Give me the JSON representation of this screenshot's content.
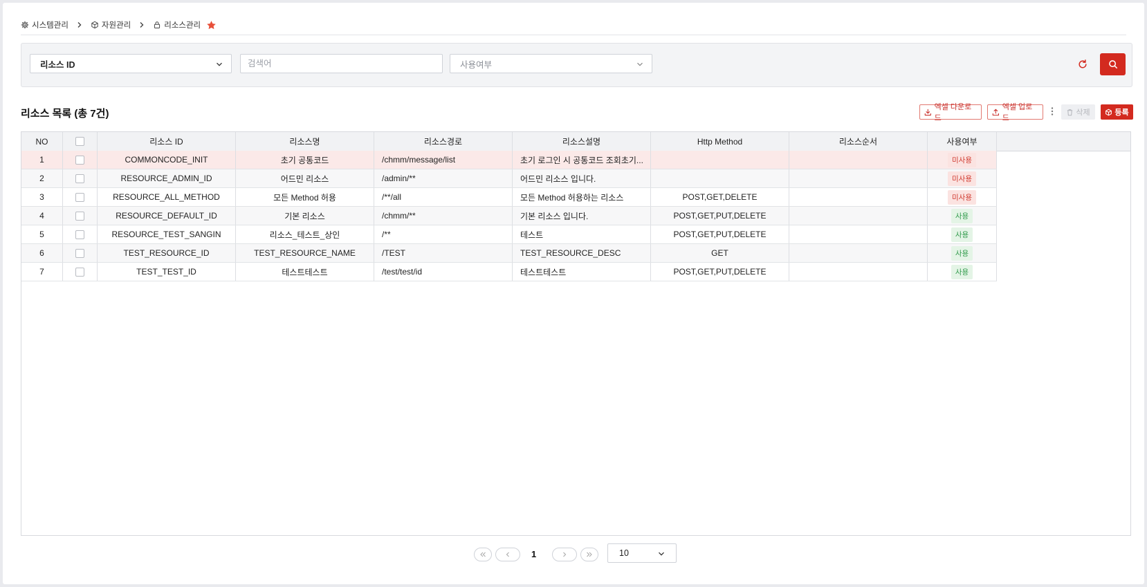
{
  "breadcrumb": {
    "items": [
      {
        "label": "시스템관리",
        "icon": "gear-icon"
      },
      {
        "label": "자원관리",
        "icon": "cube-icon"
      },
      {
        "label": "리소스관리",
        "icon": "lock-icon"
      }
    ],
    "favorite_icon": "star-icon",
    "favorite_color": "#e8503a"
  },
  "search": {
    "type_select_value": "리소스 ID",
    "keyword_placeholder": "검색어",
    "keyword_value": "",
    "use_select_placeholder": "사용여부"
  },
  "list": {
    "title": "리소스 목록",
    "count_text": "(총 7건)",
    "buttons": {
      "excel_download": "엑셀 다운로드",
      "excel_upload": "엑셀 업로드",
      "delete": "삭제",
      "register": "등록"
    }
  },
  "table": {
    "columns": [
      "NO",
      "",
      "리소스 ID",
      "리소스명",
      "리소스경로",
      "리소스설명",
      "Http Method",
      "리소스순서",
      "사용여부"
    ],
    "rows": [
      {
        "no": "1",
        "id": "COMMONCODE_INIT",
        "name": "초기 공통코드",
        "path": "/chmm/message/list",
        "desc": "초기 로그인 시 공통코드 조회초기...",
        "method": "",
        "order": "",
        "use": "미사용",
        "use_status": "off"
      },
      {
        "no": "2",
        "id": "RESOURCE_ADMIN_ID",
        "name": "어드민 리소스",
        "path": "/admin/**",
        "desc": "어드민 리소스 입니다.",
        "method": "",
        "order": "",
        "use": "미사용",
        "use_status": "off"
      },
      {
        "no": "3",
        "id": "RESOURCE_ALL_METHOD",
        "name": "모든 Method 허용",
        "path": "/**/all",
        "desc": "모든 Method 허용하는 리소스",
        "method": "POST,GET,DELETE",
        "order": "",
        "use": "미사용",
        "use_status": "off"
      },
      {
        "no": "4",
        "id": "RESOURCE_DEFAULT_ID",
        "name": "기본 리소스",
        "path": "/chmm/**",
        "desc": "기본 리소스 입니다.",
        "method": "POST,GET,PUT,DELETE",
        "order": "",
        "use": "사용",
        "use_status": "on"
      },
      {
        "no": "5",
        "id": "RESOURCE_TEST_SANGIN",
        "name": "리소스_테스트_상인",
        "path": "/**",
        "desc": "테스트",
        "method": "POST,GET,PUT,DELETE",
        "order": "",
        "use": "사용",
        "use_status": "on"
      },
      {
        "no": "6",
        "id": "TEST_RESOURCE_ID",
        "name": "TEST_RESOURCE_NAME",
        "path": "/TEST",
        "desc": "TEST_RESOURCE_DESC",
        "method": "GET",
        "order": "",
        "use": "사용",
        "use_status": "on"
      },
      {
        "no": "7",
        "id": "TEST_TEST_ID",
        "name": "테스트테스트",
        "path": "/test/test/id",
        "desc": "테스트테스트",
        "method": "POST,GET,PUT,DELETE",
        "order": "",
        "use": "사용",
        "use_status": "on"
      }
    ],
    "selected_row": 0
  },
  "pagination": {
    "current_page": "1",
    "page_size": "10"
  },
  "colors": {
    "accent": "#d32a1f",
    "badge_off": "#d03a2f",
    "badge_on": "#2f9a4a"
  }
}
